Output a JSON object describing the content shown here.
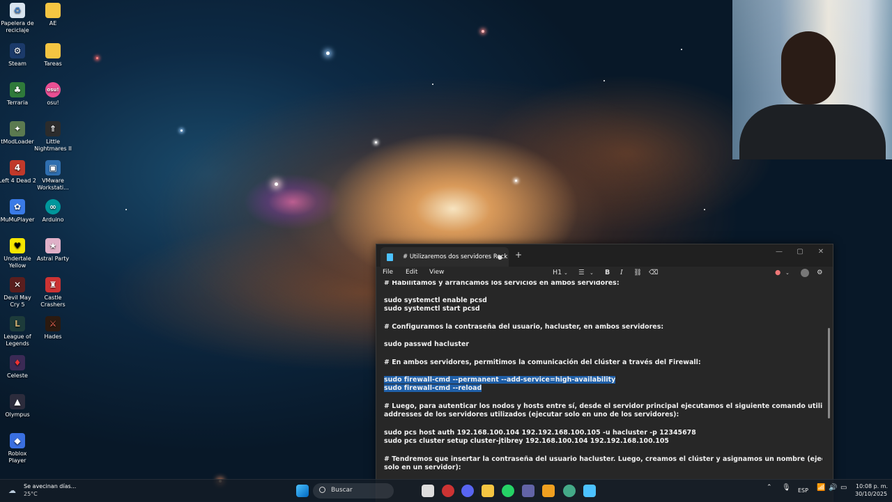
{
  "desktop": {
    "icons": [
      {
        "label": "Papelera de reciclaje",
        "icon": "recycle-bin-icon"
      },
      {
        "label": "AE",
        "icon": "folder-icon"
      },
      {
        "label": "Steam",
        "icon": "steam-icon"
      },
      {
        "label": "Tareas",
        "icon": "folder-icon"
      },
      {
        "label": "Terraria",
        "icon": "terraria-icon"
      },
      {
        "label": "osu!",
        "icon": "osu-icon"
      },
      {
        "label": "tModLoader",
        "icon": "tmodloader-icon"
      },
      {
        "label": "Little Nightmares II",
        "icon": "game-icon"
      },
      {
        "label": "Left 4 Dead 2",
        "icon": "game-icon"
      },
      {
        "label": "VMware Workstati...",
        "icon": "vmware-icon"
      },
      {
        "label": "MuMuPlayer",
        "icon": "mumu-icon"
      },
      {
        "label": "Arduino",
        "icon": "arduino-icon"
      },
      {
        "label": "Undertale Yellow",
        "icon": "game-icon"
      },
      {
        "label": "Astral Party",
        "icon": "game-icon"
      },
      {
        "label": "Devil May Cry 5",
        "icon": "game-icon"
      },
      {
        "label": "Castle Crashers",
        "icon": "game-icon"
      },
      {
        "label": "League of Legends",
        "icon": "game-icon"
      },
      {
        "label": "Hades",
        "icon": "game-icon"
      },
      {
        "label": "Celeste",
        "icon": "game-icon"
      },
      {
        "label": "Olympus",
        "icon": "game-icon"
      },
      {
        "label": "Roblox Player",
        "icon": "roblox-icon"
      }
    ]
  },
  "notepad": {
    "tab_title": "# Utilizaremos dos servidores Rock",
    "menu": {
      "file": "File",
      "edit": "Edit",
      "view": "View"
    },
    "toolbar": {
      "heading": "H1",
      "bold": "B",
      "italic": "I"
    },
    "lines": [
      "# Habilitamos y arrancamos los servicios en ambos servidores:",
      "sudo systemctl enable pcsd",
      "sudo systemctl start pcsd",
      "# Configuramos la contraseña del usuario, hacluster, en ambos servidores:",
      "sudo passwd hacluster",
      "# En ambos servidores, permitimos la comunicación del clúster a través del Firewall:",
      "sudo firewall-cmd --permanent --add-service=high-availability",
      "sudo firewall-cmd --reload",
      "# Luego, para autenticar los nodos y hosts entre sí, desde el servidor principal ejecutamos el siguiente comando utilizando las IP",
      "addresses de los servidores utilizados (ejecutar solo en uno de los servidores):",
      "sudo pcs host auth 192.168.100.104 192.192.168.100.105 -u hacluster -p 12345678",
      "sudo pcs cluster setup cluster-jtibrey 192.168.100.104 192.192.168.100.105",
      "# Tendremos que insertar la contraseña del usuario hacluster. Luego, creamos el clúster y asignamos un nombre (ejecutamos",
      "solo en un servidor):"
    ]
  },
  "taskbar": {
    "weather_text": "Se avecinan días...",
    "weather_temp": "25°C",
    "search_placeholder": "Buscar",
    "language": "ESP",
    "time": "10:08 p. m.",
    "date": "30/10/2025"
  }
}
